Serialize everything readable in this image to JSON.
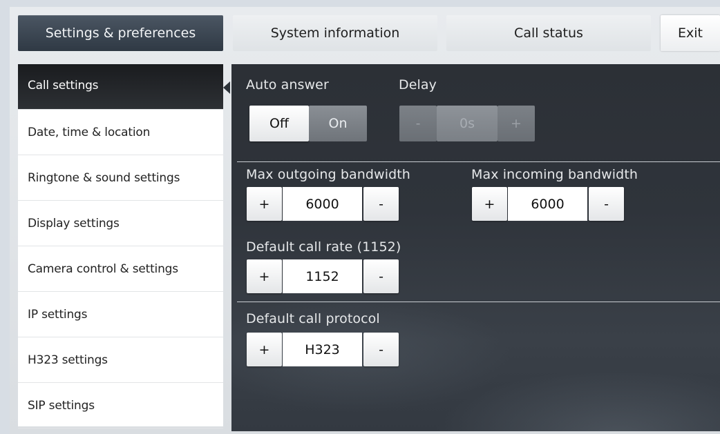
{
  "tabs": [
    {
      "label": "Settings & preferences"
    },
    {
      "label": "System information"
    },
    {
      "label": "Call status"
    },
    {
      "label": "Exit"
    }
  ],
  "sidebar": {
    "items": [
      {
        "label": "Call settings"
      },
      {
        "label": "Date, time & location"
      },
      {
        "label": "Ringtone & sound settings"
      },
      {
        "label": "Display settings"
      },
      {
        "label": "Camera control & settings"
      },
      {
        "label": "IP settings"
      },
      {
        "label": "H323 settings"
      },
      {
        "label": "SIP settings"
      }
    ]
  },
  "call_settings": {
    "auto_answer": {
      "label": "Auto answer",
      "off": "Off",
      "on": "On",
      "selected": "Off"
    },
    "delay": {
      "label": "Delay",
      "minus": "-",
      "value": "0s",
      "plus": "+",
      "enabled": false
    },
    "max_outgoing": {
      "label": "Max outgoing bandwidth",
      "plus": "+",
      "value": "6000",
      "minus": "-"
    },
    "max_incoming": {
      "label": "Max incoming bandwidth",
      "plus": "+",
      "value": "6000",
      "minus": "-"
    },
    "default_call_rate": {
      "label": "Default call rate (1152)",
      "plus": "+",
      "value": "1152",
      "minus": "-"
    },
    "default_call_protocol": {
      "label": "Default call protocol",
      "plus": "+",
      "value": "H323",
      "minus": "-"
    }
  },
  "colors": {
    "active_tab": "#3b4552",
    "panel_bg": "#2f343b",
    "sidebar_active": "#1f2226"
  }
}
